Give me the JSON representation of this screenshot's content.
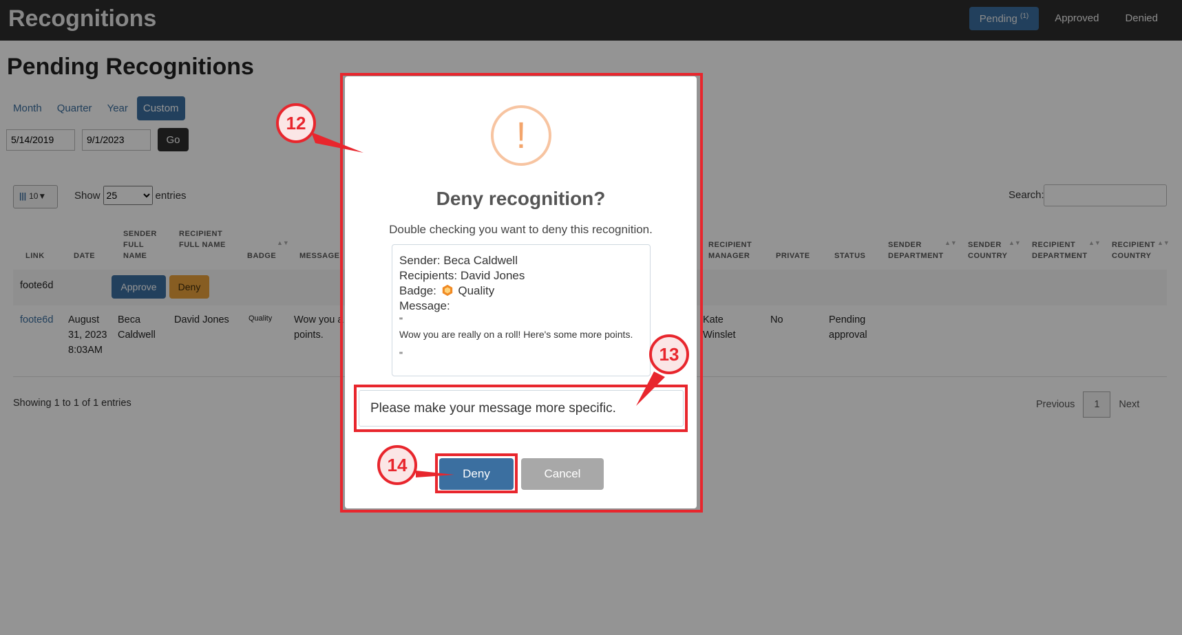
{
  "header": {
    "app_title": "Recognitions",
    "nav": [
      {
        "label": "Pending",
        "count": "(1)"
      },
      {
        "label": "Approved"
      },
      {
        "label": "Denied"
      }
    ]
  },
  "page": {
    "title": "Pending Recognitions",
    "range_tabs": [
      "Month",
      "Quarter",
      "Year",
      "Custom"
    ],
    "active_range": "Custom",
    "start_date": "5/14/2019",
    "end_date": "9/1/2023",
    "go_label": "Go"
  },
  "table_controls": {
    "column_button_label": "10▼",
    "show_label": "Show",
    "entries_value": "25",
    "entries_label": "entries",
    "search_label": "Search:"
  },
  "table": {
    "headers": {
      "link": "LINK",
      "date": "DATE",
      "sender_full_name": "SENDER FULL NAME",
      "recipient_full_name": "RECIPIENT FULL NAME",
      "badge": "BADGE",
      "message": "MESSAGE",
      "recipient_manager": "RECIPIENT MANAGER",
      "private": "PRIVATE",
      "status": "STATUS",
      "sender_department": "SENDER DEPARTMENT",
      "sender_country": "SENDER COUNTRY",
      "recipient_department": "RECIPIENT DEPARTMENT",
      "recipient_country": "RECIPIENT COUNTRY"
    },
    "filter_row": {
      "link": "foote6d",
      "approve_label": "Approve",
      "deny_label": "Deny"
    },
    "row": {
      "link": "foote6d",
      "date": "August 31, 2023 8:03AM",
      "sender": "Beca Caldwell",
      "recipient": "David Jones",
      "badge": "Quality",
      "message": "Wow you a points.",
      "recipient_manager": "Kate Winslet",
      "private": "No",
      "status": "Pending approval"
    }
  },
  "footer": {
    "showing": "Showing 1 to 1 of 1 entries",
    "previous": "Previous",
    "page": "1",
    "next": "Next"
  },
  "modal": {
    "icon": "!",
    "title": "Deny recognition?",
    "subtitle": "Double checking you want to deny this recognition.",
    "sender": "Sender: Beca Caldwell",
    "recipients": "Recipients: David Jones",
    "badge_prefix": "Badge:",
    "badge_name": "Quality",
    "message_label": "Message:",
    "quote_open": "\"",
    "message_text": "Wow you are really on a roll! Here's some more points.",
    "quote_close": "\"",
    "reason_value": "Please make your message more specific.",
    "deny_label": "Deny",
    "cancel_label": "Cancel"
  },
  "annotations": {
    "callout_12": "12",
    "callout_13": "13",
    "callout_14": "14",
    "color": "#e8262d"
  },
  "colors": {
    "primary": "#3b6fa0",
    "warning": "#e8a13c",
    "topbar": "#2d2d2d"
  }
}
